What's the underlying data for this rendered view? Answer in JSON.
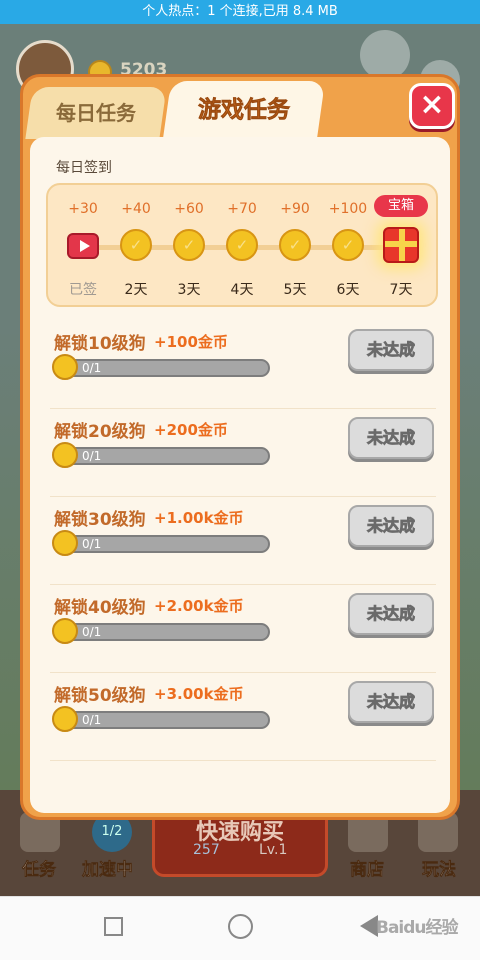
{
  "statusbar": {
    "text": "个人热点：1 个连接,已用 8.4 MB"
  },
  "background": {
    "coins": "5203",
    "bottom_bar": {
      "tasks": "任务",
      "speedup": "加速中",
      "speedup_badge": "1/2",
      "center_title": "快速购买",
      "center_gems": "257",
      "center_level": "Lv.1",
      "shop": "商店",
      "howto": "玩法"
    }
  },
  "modal": {
    "tabs": [
      {
        "label": "每日任务",
        "active": false
      },
      {
        "label": "游戏任务",
        "active": true
      }
    ],
    "close_label": "×",
    "checkin": {
      "title": "每日签到",
      "days": [
        {
          "bonus": "+30",
          "label": "已签",
          "icon": "video-icon",
          "done": true
        },
        {
          "bonus": "+40",
          "label": "2天",
          "icon": "coin-icon",
          "done": false
        },
        {
          "bonus": "+60",
          "label": "3天",
          "icon": "coin-icon",
          "done": false
        },
        {
          "bonus": "+70",
          "label": "4天",
          "icon": "coin-icon",
          "done": false
        },
        {
          "bonus": "+90",
          "label": "5天",
          "icon": "coin-icon",
          "done": false
        },
        {
          "bonus": "+100",
          "label": "6天",
          "icon": "coin-icon",
          "done": false
        },
        {
          "bonus": "宝箱",
          "label": "7天",
          "icon": "gift-icon",
          "done": false
        }
      ]
    },
    "tasks": [
      {
        "title": "解锁10级狗",
        "reward": "+100金币",
        "progress": "0/1",
        "button": "未达成"
      },
      {
        "title": "解锁20级狗",
        "reward": "+200金币",
        "progress": "0/1",
        "button": "未达成"
      },
      {
        "title": "解锁30级狗",
        "reward": "+1.00k金币",
        "progress": "0/1",
        "button": "未达成"
      },
      {
        "title": "解锁40级狗",
        "reward": "+2.00k金币",
        "progress": "0/1",
        "button": "未达成"
      },
      {
        "title": "解锁50级狗",
        "reward": "+3.00k金币",
        "progress": "0/1",
        "button": "未达成"
      }
    ]
  },
  "navbar": {
    "watermark": "Baidu经验"
  },
  "colors": {
    "accent": "#ec7d1f",
    "modal": "#f0a24a",
    "panel": "#fdf6ea",
    "close": "#e8364a",
    "statusbar": "#29a9e6"
  }
}
